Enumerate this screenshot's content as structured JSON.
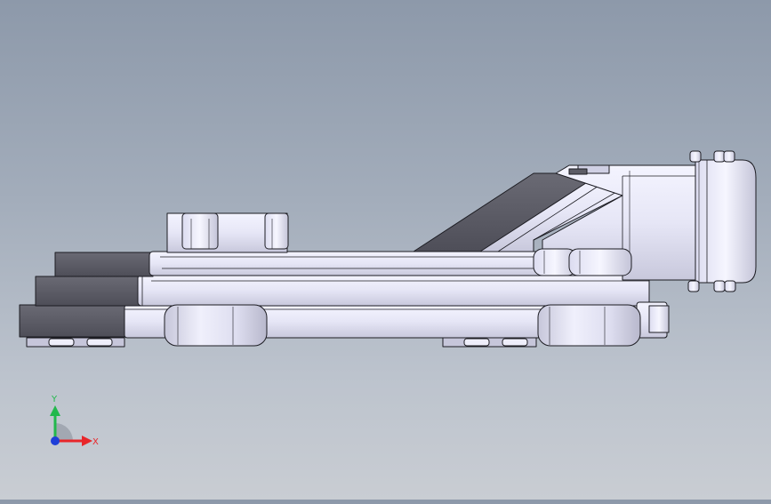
{
  "viewport": {
    "background_top": "#8d99aa",
    "background_bottom": "#c9cdd3",
    "model_colors": {
      "light": "#eeeefb",
      "mid": "#d6d6ea",
      "shade": "#b4b4c9",
      "dark": "#5c5c66",
      "edge": "#1c1c22"
    }
  },
  "triad": {
    "x_label": "X",
    "y_label": "Y",
    "x_color": "#e8262a",
    "y_color": "#22b84c",
    "z_color": "#1f3fd8"
  }
}
